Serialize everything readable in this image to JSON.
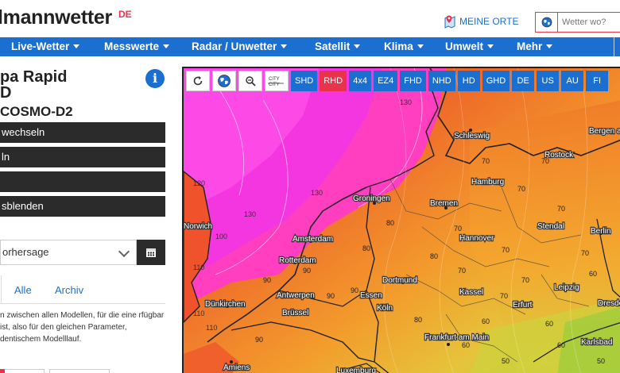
{
  "header": {
    "logo_text": "lmannwetter",
    "logo_suffix": "DE",
    "meine_orte": "MEINE ORTE",
    "search_placeholder": "Wetter wo?"
  },
  "nav": {
    "items": [
      "Live-Wetter",
      "Messwerte",
      "Radar / Unwetter",
      "Satellit",
      "Klima",
      "Umwelt",
      "Mehr"
    ]
  },
  "left": {
    "title_line1": "pa Rapid",
    "title_line2": "D",
    "subtitle": "COSMO-D2",
    "buttons": [
      "wechseln",
      "ln",
      "",
      "sblenden"
    ],
    "select_value": "orhersage",
    "tabs": [
      "Alle",
      "Archiv"
    ],
    "description": "n zwischen allen Modellen, für die eine rfügbar ist, also für den gleichen Parameter, dentischem Modelllauf."
  },
  "map": {
    "tools": [
      "refresh-icon",
      "globe-icon",
      "zoom-icon",
      "city-toggle-icon"
    ],
    "city_tool_label": "CITY",
    "regions": [
      "SHD",
      "RHD",
      "4x4",
      "EZ4",
      "FHD",
      "NHD",
      "HD",
      "GHD",
      "DE",
      "US",
      "AU",
      "FI"
    ],
    "active_region": "RHD",
    "cities": [
      "Schleswig",
      "Bergen auf Rügen",
      "Rostock",
      "Hamburg",
      "Groningen",
      "Bremen",
      "Amsterdam",
      "Hannover",
      "Stendal",
      "Berlin",
      "Rotterdam",
      "Dortmund",
      "Antwerpen",
      "Essen",
      "Kassel",
      "Leipzig",
      "Brüssel",
      "Köln",
      "Erfurt",
      "Dresden",
      "Dünkirchen",
      "Frankfurt am Main",
      "Karlsbad",
      "Amiens",
      "Luxemburg",
      "Norwich"
    ],
    "isolines": [
      "130",
      "130",
      "130",
      "120",
      "110",
      "110",
      "90",
      "90",
      "80",
      "80",
      "80",
      "70",
      "70",
      "70",
      "70",
      "70",
      "70",
      "70",
      "70",
      "70",
      "60",
      "60",
      "60",
      "60",
      "60",
      "50",
      "50",
      "90",
      "80",
      "70",
      "110",
      "90",
      "100",
      "90"
    ]
  },
  "colors": {
    "brand_blue": "#1a6fd1",
    "brand_red": "#e8334a",
    "dark_button": "#2b2b2b"
  }
}
